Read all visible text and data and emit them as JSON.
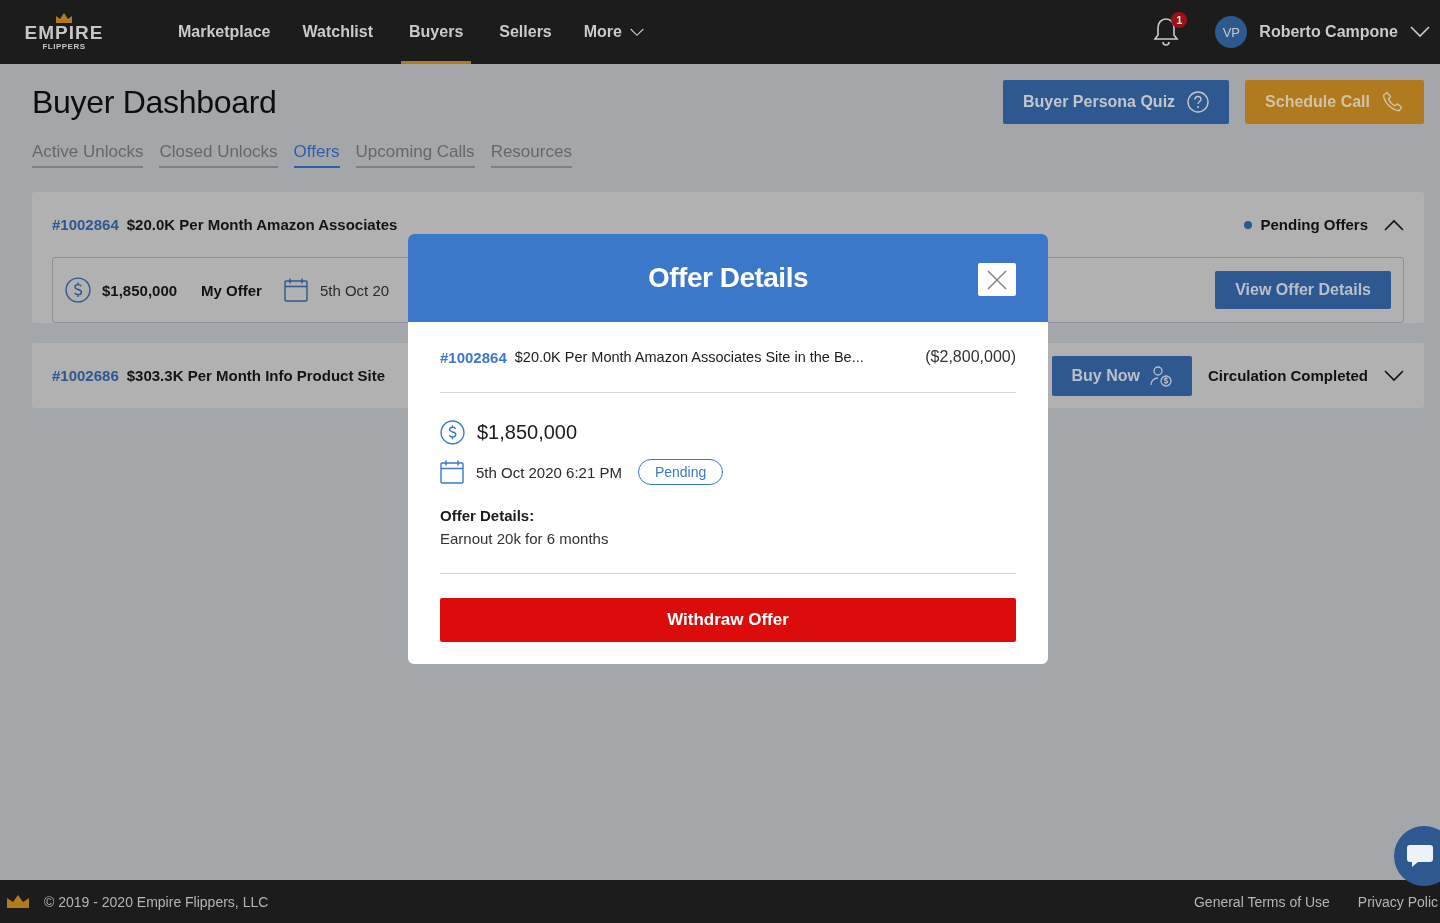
{
  "logo": {
    "wordmark": "EMPIRE",
    "tagline": "FLIPPERS"
  },
  "nav": [
    {
      "label": "Marketplace",
      "selected": false
    },
    {
      "label": "Watchlist",
      "selected": false
    },
    {
      "label": "Buyers",
      "selected": true
    },
    {
      "label": "Sellers",
      "selected": false
    },
    {
      "label": "More",
      "selected": false,
      "kind": "dropdown"
    }
  ],
  "notifications": {
    "count": "1"
  },
  "user": {
    "initials": "VP",
    "name": "Roberto Campone"
  },
  "page_title": "Buyer Dashboard",
  "header_buttons": [
    {
      "label": "Buyer Persona Quiz",
      "kind": "quiz"
    },
    {
      "label": "Schedule Call",
      "kind": "call"
    }
  ],
  "tabs": [
    {
      "label": "Active Unlocks",
      "selected": false
    },
    {
      "label": "Closed Unlocks",
      "selected": false
    },
    {
      "label": "Offers",
      "selected": true
    },
    {
      "label": "Upcoming Calls",
      "selected": false
    },
    {
      "label": "Resources",
      "selected": false
    }
  ],
  "listings": [
    {
      "id": "#1002864",
      "title": "$20.0K Per Month Amazon Associates",
      "status": "Pending Offers",
      "color": "#2d5890",
      "expanded": true,
      "offer": {
        "amount": "$1,850,000",
        "label": "My Offer",
        "date": "5th Oct 20",
        "button": "View Offer Details"
      }
    },
    {
      "id": "#1002686",
      "title": "$303.3K Per Month Info Product Site",
      "status": "Circulation Completed",
      "expanded": false,
      "button": "Buy Now"
    }
  ],
  "modal": {
    "title": "Offer Details",
    "listing_id": "#1002864",
    "listing_title": "$20.0K Per Month Amazon Associates Site in the Be...",
    "price": "($2,800,000)",
    "amount": "$1,850,000",
    "date": "5th Oct 2020 6:21 PM",
    "status": "Pending",
    "details_label": "Offer Details:",
    "details_text": "Earnout 20k for 6 months",
    "action": "Withdraw Offer"
  },
  "footer": {
    "copyright": "© 2019 - 2020 Empire Flippers, LLC",
    "links": [
      "General Terms of Use",
      "Privacy Polic"
    ]
  }
}
